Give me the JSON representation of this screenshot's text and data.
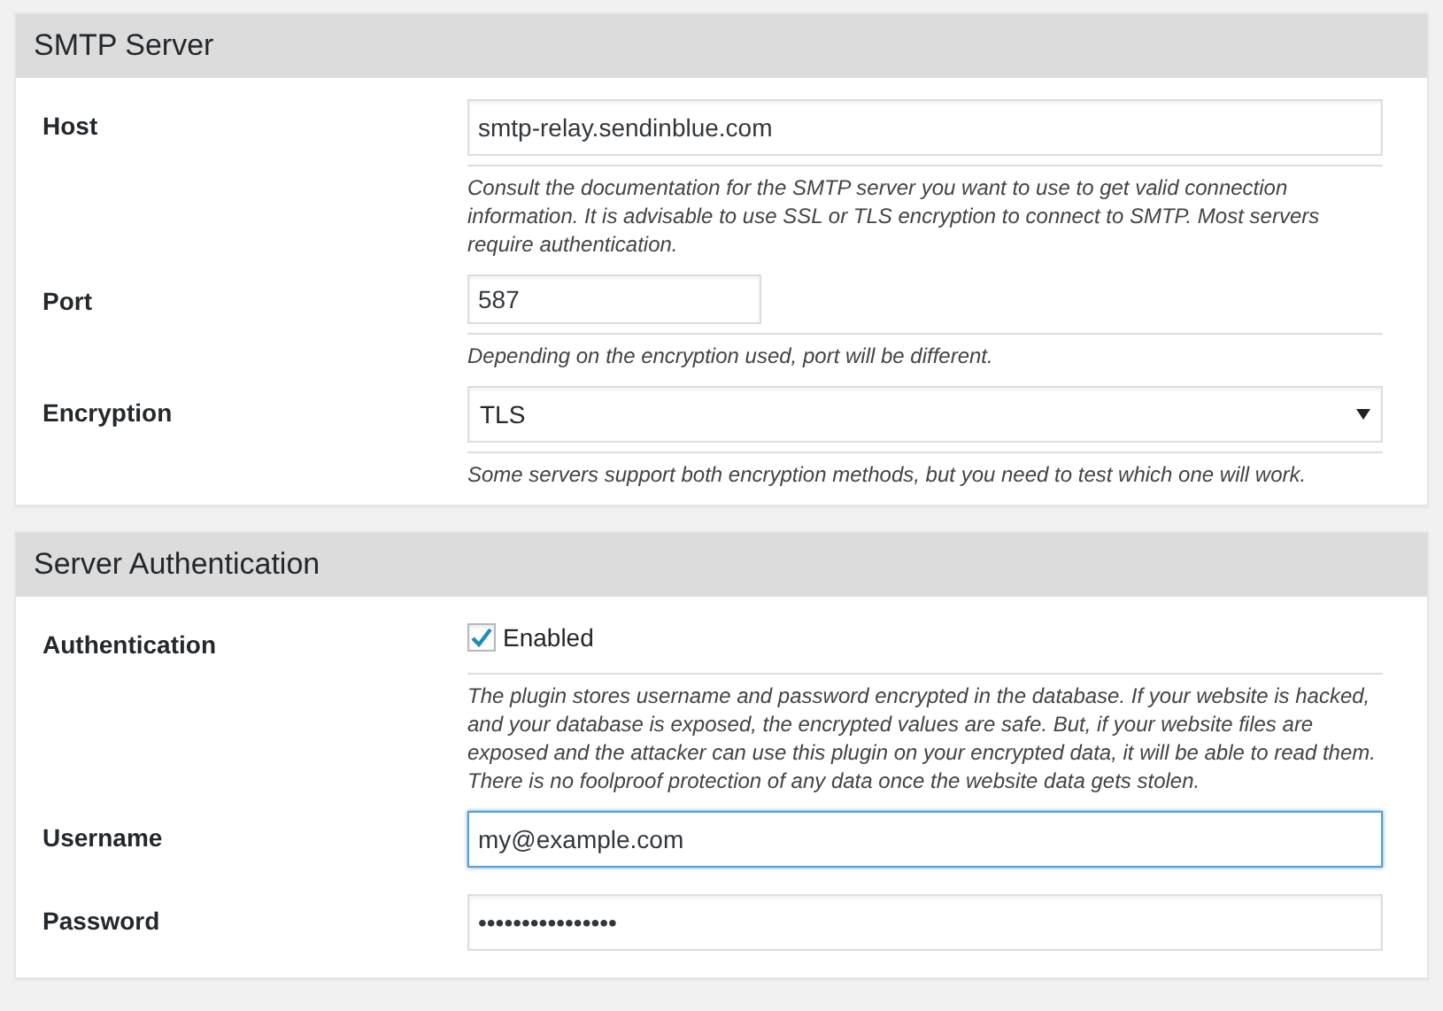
{
  "sections": [
    {
      "title": "SMTP Server",
      "fields": [
        {
          "kind": "text",
          "label": "Host",
          "value": "smtp-relay.sendinblue.com",
          "focused": false,
          "description": "Consult the documentation for the SMTP server you want to use to get valid connection information. It is advisable to use SSL or TLS encryption to connect to SMTP. Most servers require authentication."
        },
        {
          "kind": "short-text",
          "label": "Port",
          "value": "587",
          "focused": false,
          "description": "Depending on the encryption used, port will be different."
        },
        {
          "kind": "select",
          "label": "Encryption",
          "value": "TLS",
          "description": "Some servers support both encryption methods, but you need to test which one will work."
        }
      ]
    },
    {
      "title": "Server Authentication",
      "fields": [
        {
          "kind": "checkbox",
          "label": "Authentication",
          "value": "Enabled",
          "checked": true,
          "description": "The plugin stores username and password encrypted in the database. If your website is hacked, and your database is exposed, the encrypted values are safe. But, if your website files are exposed and the attacker can use this plugin on your encrypted data, it will be able to read them. There is no foolproof protection of any data once the website data gets stolen."
        },
        {
          "kind": "text",
          "label": "Username",
          "value": "my@example.com",
          "focused": true
        },
        {
          "kind": "password",
          "label": "Password",
          "value": "••••••••••••••••",
          "focused": false
        }
      ]
    }
  ]
}
